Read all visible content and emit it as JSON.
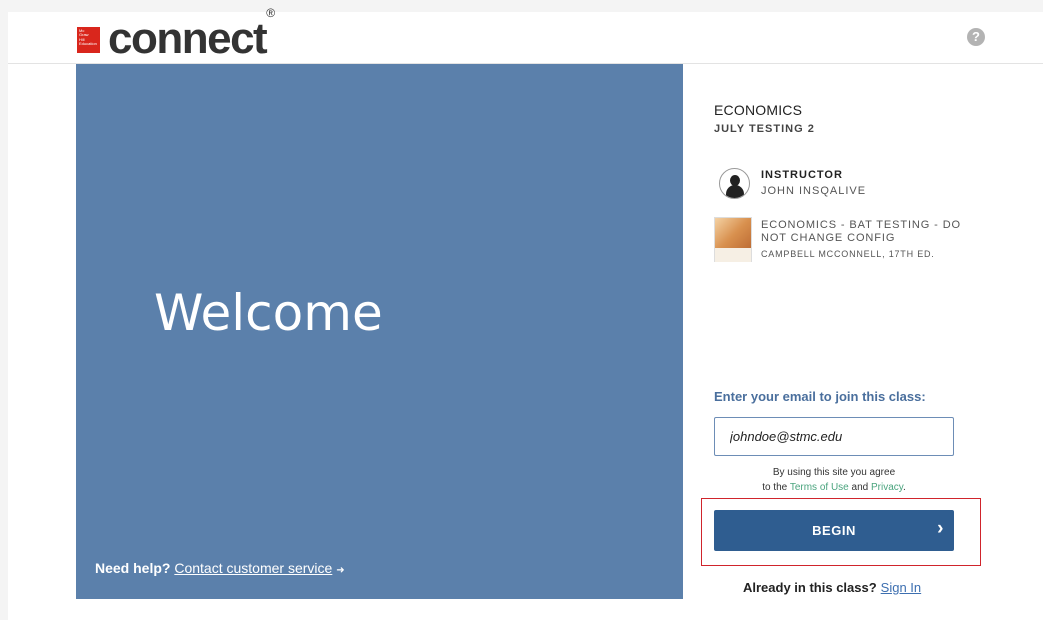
{
  "header": {
    "logo_lines": [
      "Mc",
      "Graw",
      "Hill",
      "Education"
    ],
    "brand": "connect",
    "brand_mark": "®",
    "help_glyph": "?"
  },
  "hero": {
    "welcome": "Welcome",
    "help_prefix": "Need help?",
    "help_link": "Contact customer service",
    "help_arrow": "➜",
    "bg_color": "#5b80ab"
  },
  "course": {
    "title": "ECONOMICS",
    "section": "JULY TESTING 2",
    "instructor_label": "INSTRUCTOR",
    "instructor_name": "JOHN INSQALIVE",
    "book_title": "ECONOMICS - BAT TESTING - DO NOT CHANGE CONFIG",
    "book_author": "CAMPBELL MCCONNELL, 17TH ED."
  },
  "join": {
    "label": "Enter your email to join this class:",
    "email_value": "johndoe@stmc.edu",
    "agree_line1": "By using this site you agree",
    "agree_prefix": "to the",
    "terms": "Terms of Use",
    "and": "and",
    "privacy": "Privacy",
    "period": ".",
    "begin_label": "BEGIN",
    "begin_chevron": "›",
    "already": "Already in this class?",
    "sign_in": "Sign In",
    "accent_color": "#2f5d90",
    "highlight_color": "#d0242c"
  }
}
